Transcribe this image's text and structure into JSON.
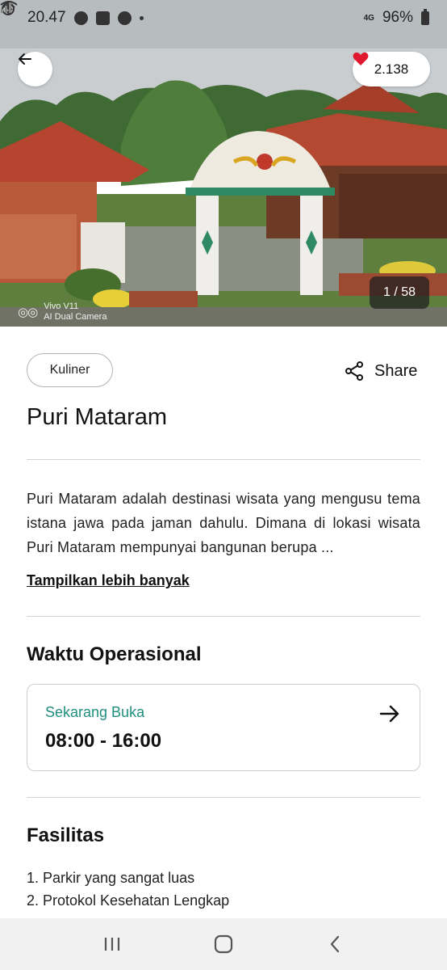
{
  "status_bar": {
    "time": "20.47",
    "network": "4G",
    "battery": "96%"
  },
  "hero": {
    "likes": "2.138",
    "image_counter": "1 / 58",
    "watermark_brand": "Vivo V11",
    "watermark_sub": "AI Dual Camera"
  },
  "place": {
    "category": "Kuliner",
    "share_label": "Share",
    "name": "Puri Mataram",
    "description": "Puri Mataram adalah destinasi wisata yang mengusu tema istana jawa pada jaman dahulu. Dimana di lokasi wisata Puri Mataram mempunyai bangunan berupa ...",
    "show_more_label": "Tampilkan lebih banyak"
  },
  "operational": {
    "section_title": "Waktu Operasional",
    "status": "Sekarang Buka",
    "hours": "08:00 - 16:00"
  },
  "facilities": {
    "section_title": "Fasilitas",
    "items": [
      "1. Parkir yang sangat luas",
      "2. Protokol Kesehatan Lengkap"
    ]
  },
  "colors": {
    "accent_teal": "#1f8f7e",
    "heart_red": "#e0182d"
  },
  "icons": [
    "back-arrow-icon",
    "heart-icon",
    "share-icon",
    "arrow-right-icon",
    "recents-icon",
    "home-icon",
    "back-nav-icon"
  ]
}
